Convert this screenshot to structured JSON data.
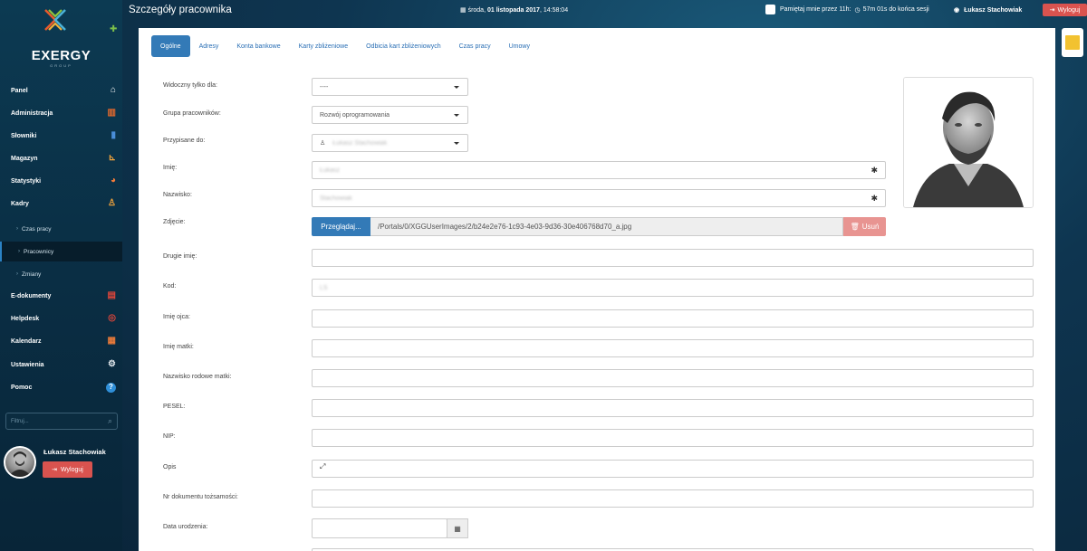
{
  "brand": {
    "name": "EXERGY",
    "sub": "GROUP"
  },
  "header": {
    "title": "Szczegóły pracownika",
    "date_prefix": "środa, ",
    "date_bold": "01 listopada 2017",
    "time": ", 14:58:04",
    "remember_label": "Pamiętaj mnie przez 11h:",
    "session_label": "57m 01s  do końca sesji",
    "user_name": "Łukasz Stachowiak",
    "logout_label": "Wyloguj"
  },
  "sidebar": {
    "items": [
      {
        "label": "Panel",
        "icon": "home-icon",
        "glyph": "🏠"
      },
      {
        "label": "Administracja",
        "icon": "books-icon",
        "glyph": "📚"
      },
      {
        "label": "Słowniki",
        "icon": "book-icon",
        "glyph": "📘"
      },
      {
        "label": "Magazyn",
        "icon": "forklift-icon",
        "glyph": "🚜"
      },
      {
        "label": "Statystyki",
        "icon": "pie-chart-icon",
        "glyph": "◕"
      },
      {
        "label": "Kadry",
        "icon": "person-icon",
        "glyph": "🧍"
      }
    ],
    "subitems": [
      {
        "label": "Czas pracy"
      },
      {
        "label": "Pracownicy"
      },
      {
        "label": "Zmiany"
      }
    ],
    "items2": [
      {
        "label": "E-dokumenty",
        "icon": "pdf-icon",
        "glyph": "📄"
      },
      {
        "label": "Helpdesk",
        "icon": "lifebuoy-icon",
        "glyph": "⛑"
      },
      {
        "label": "Kalendarz",
        "icon": "calendar-icon",
        "glyph": "📅"
      },
      {
        "label": "Ustawienia",
        "icon": "gear-icon",
        "glyph": "⚙"
      },
      {
        "label": "Pomoc",
        "icon": "help-icon",
        "glyph": "?"
      }
    ],
    "filter_placeholder": "Filtruj...",
    "user_name": "Łukasz Stachowiak",
    "logout_label": "Wyloguj"
  },
  "tabs": [
    "Ogólne",
    "Adresy",
    "Konta bankowe",
    "Karty zbliżeniowe",
    "Odbicia kart zbliżeniowych",
    "Czas pracy",
    "Umowy"
  ],
  "form": {
    "visible_for": {
      "label": "Widoczny tylko dla:",
      "value": "----"
    },
    "group": {
      "label": "Grupa pracowników:",
      "value": "Rozwój oprogramowania"
    },
    "assigned_to": {
      "label": "Przypisane do:",
      "value": "Łukasz Stachowiak"
    },
    "first_name": {
      "label": "Imię:",
      "value": "Łukasz"
    },
    "last_name": {
      "label": "Nazwisko:",
      "value": "Stachowiak"
    },
    "photo": {
      "label": "Zdjęcie:",
      "browse": "Przeglądaj...",
      "path": "/Portals/0/XGGUserImages/2/b24e2e76-1c93-4e03-9d36-30e406768d70_a.jpg",
      "delete": "Usuń"
    },
    "second_name": {
      "label": "Drugie imię:",
      "value": ""
    },
    "code": {
      "label": "Kod:",
      "value": "LS"
    },
    "father_name": {
      "label": "Imię ojca:",
      "value": ""
    },
    "mother_name": {
      "label": "Imię matki:",
      "value": ""
    },
    "mother_maiden": {
      "label": "Nazwisko rodowe matki:",
      "value": ""
    },
    "pesel": {
      "label": "PESEL:",
      "value": ""
    },
    "nip": {
      "label": "NIP:",
      "value": ""
    },
    "description": {
      "label": "Opis",
      "value": ""
    },
    "id_doc": {
      "label": "Nr dokumentu tożsamości:",
      "value": ""
    },
    "birth_date": {
      "label": "Data urodzenia:",
      "value": ""
    }
  },
  "colors": {
    "accent": "#337ab7",
    "danger": "#d9534f",
    "sidebar_bg": "#0c3a52"
  }
}
